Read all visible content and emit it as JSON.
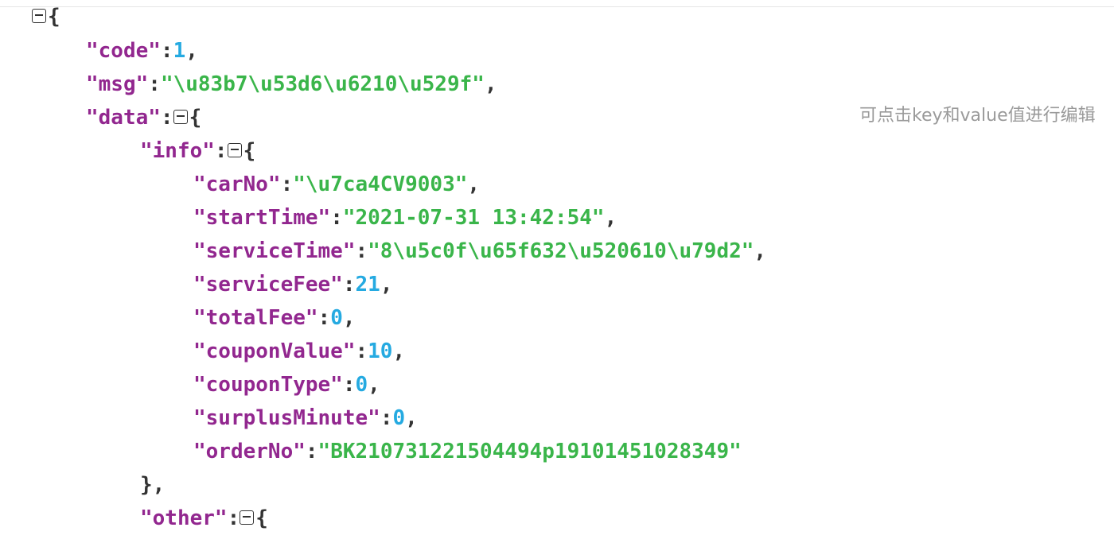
{
  "hint": "可点击key和value值进行编辑",
  "json": {
    "root_open": "{",
    "code_key": "\"code\"",
    "code_val": "1",
    "msg_key": "\"msg\"",
    "msg_val": "\"\\u83b7\\u53d6\\u6210\\u529f\"",
    "data_key": "\"data\"",
    "info_key": "\"info\"",
    "carNo_key": "\"carNo\"",
    "carNo_val": "\"\\u7ca4CV9003\"",
    "startTime_key": "\"startTime\"",
    "startTime_val": "\"2021-07-31 13:42:54\"",
    "serviceTime_key": "\"serviceTime\"",
    "serviceTime_val": "\"8\\u5c0f\\u65f632\\u520610\\u79d2\"",
    "serviceFee_key": "\"serviceFee\"",
    "serviceFee_val": "21",
    "totalFee_key": "\"totalFee\"",
    "totalFee_val": "0",
    "couponValue_key": "\"couponValue\"",
    "couponValue_val": "10",
    "couponType_key": "\"couponType\"",
    "couponType_val": "0",
    "surplusMinute_key": "\"surplusMinute\"",
    "surplusMinute_val": "0",
    "orderNo_key": "\"orderNo\"",
    "orderNo_val": "\"BK210731221504494p19101451028349\"",
    "info_close": "},",
    "other_key": "\"other\"",
    "colon": ":",
    "comma": ",",
    "open_brace": "{"
  }
}
